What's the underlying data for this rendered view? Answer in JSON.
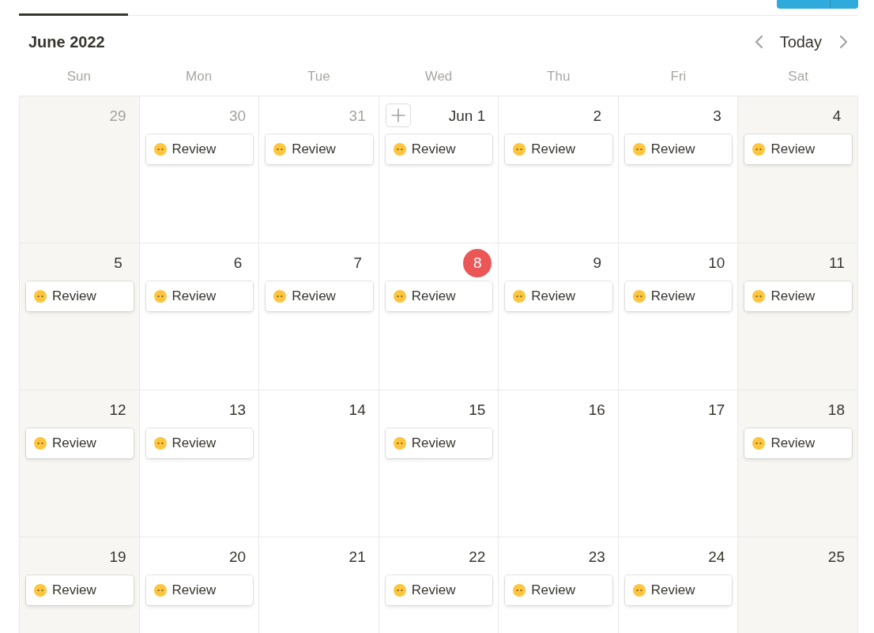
{
  "view_tabs": [
    {
      "selected": true
    }
  ],
  "calendar": {
    "title": "June 2022",
    "today_button": "Today"
  },
  "weekdays": [
    {
      "label": "Sun",
      "weekend": true
    },
    {
      "label": "Mon",
      "weekend": false
    },
    {
      "label": "Tue",
      "weekend": false
    },
    {
      "label": "Wed",
      "weekend": false
    },
    {
      "label": "Thu",
      "weekend": false
    },
    {
      "label": "Fri",
      "weekend": false
    },
    {
      "label": "Sat",
      "weekend": true
    }
  ],
  "weeks": [
    [
      {
        "day": "29",
        "outside_month": true,
        "today": false,
        "hovered": false
      },
      {
        "day": "30",
        "outside_month": true,
        "today": false,
        "hovered": false,
        "events": [
          {
            "title": "Review"
          }
        ]
      },
      {
        "day": "31",
        "outside_month": true,
        "today": false,
        "hovered": false,
        "events": [
          {
            "title": "Review"
          }
        ]
      },
      {
        "day": "Jun 1",
        "outside_month": false,
        "today": false,
        "hovered": true,
        "events": [
          {
            "title": "Review"
          }
        ]
      },
      {
        "day": "2",
        "outside_month": false,
        "today": false,
        "hovered": false,
        "events": [
          {
            "title": "Review"
          }
        ]
      },
      {
        "day": "3",
        "outside_month": false,
        "today": false,
        "hovered": false,
        "events": [
          {
            "title": "Review"
          }
        ]
      },
      {
        "day": "4",
        "outside_month": false,
        "today": false,
        "hovered": false,
        "events": [
          {
            "title": "Review"
          }
        ]
      }
    ],
    [
      {
        "day": "5",
        "outside_month": false,
        "today": false,
        "hovered": false,
        "events": [
          {
            "title": "Review"
          }
        ]
      },
      {
        "day": "6",
        "outside_month": false,
        "today": false,
        "hovered": false,
        "events": [
          {
            "title": "Review"
          }
        ]
      },
      {
        "day": "7",
        "outside_month": false,
        "today": false,
        "hovered": false,
        "events": [
          {
            "title": "Review"
          }
        ]
      },
      {
        "day": "8",
        "outside_month": false,
        "today": true,
        "hovered": false,
        "events": [
          {
            "title": "Review"
          }
        ]
      },
      {
        "day": "9",
        "outside_month": false,
        "today": false,
        "hovered": false,
        "events": [
          {
            "title": "Review"
          }
        ]
      },
      {
        "day": "10",
        "outside_month": false,
        "today": false,
        "hovered": false,
        "events": [
          {
            "title": "Review"
          }
        ]
      },
      {
        "day": "11",
        "outside_month": false,
        "today": false,
        "hovered": false,
        "events": [
          {
            "title": "Review"
          }
        ]
      }
    ],
    [
      {
        "day": "12",
        "outside_month": false,
        "today": false,
        "hovered": false,
        "events": [
          {
            "title": "Review"
          }
        ]
      },
      {
        "day": "13",
        "outside_month": false,
        "today": false,
        "hovered": false,
        "events": [
          {
            "title": "Review"
          }
        ]
      },
      {
        "day": "14",
        "outside_month": false,
        "today": false,
        "hovered": false
      },
      {
        "day": "15",
        "outside_month": false,
        "today": false,
        "hovered": false,
        "events": [
          {
            "title": "Review"
          }
        ]
      },
      {
        "day": "16",
        "outside_month": false,
        "today": false,
        "hovered": false
      },
      {
        "day": "17",
        "outside_month": false,
        "today": false,
        "hovered": false
      },
      {
        "day": "18",
        "outside_month": false,
        "today": false,
        "hovered": false,
        "events": [
          {
            "title": "Review"
          }
        ]
      }
    ],
    [
      {
        "day": "19",
        "outside_month": false,
        "today": false,
        "hovered": false,
        "events": [
          {
            "title": "Review"
          }
        ]
      },
      {
        "day": "20",
        "outside_month": false,
        "today": false,
        "hovered": false,
        "events": [
          {
            "title": "Review"
          }
        ]
      },
      {
        "day": "21",
        "outside_month": false,
        "today": false,
        "hovered": false
      },
      {
        "day": "22",
        "outside_month": false,
        "today": false,
        "hovered": false,
        "events": [
          {
            "title": "Review"
          }
        ]
      },
      {
        "day": "23",
        "outside_month": false,
        "today": false,
        "hovered": false,
        "events": [
          {
            "title": "Review"
          }
        ]
      },
      {
        "day": "24",
        "outside_month": false,
        "today": false,
        "hovered": false,
        "events": [
          {
            "title": "Review"
          }
        ]
      },
      {
        "day": "25",
        "outside_month": false,
        "today": false,
        "hovered": false
      }
    ]
  ]
}
